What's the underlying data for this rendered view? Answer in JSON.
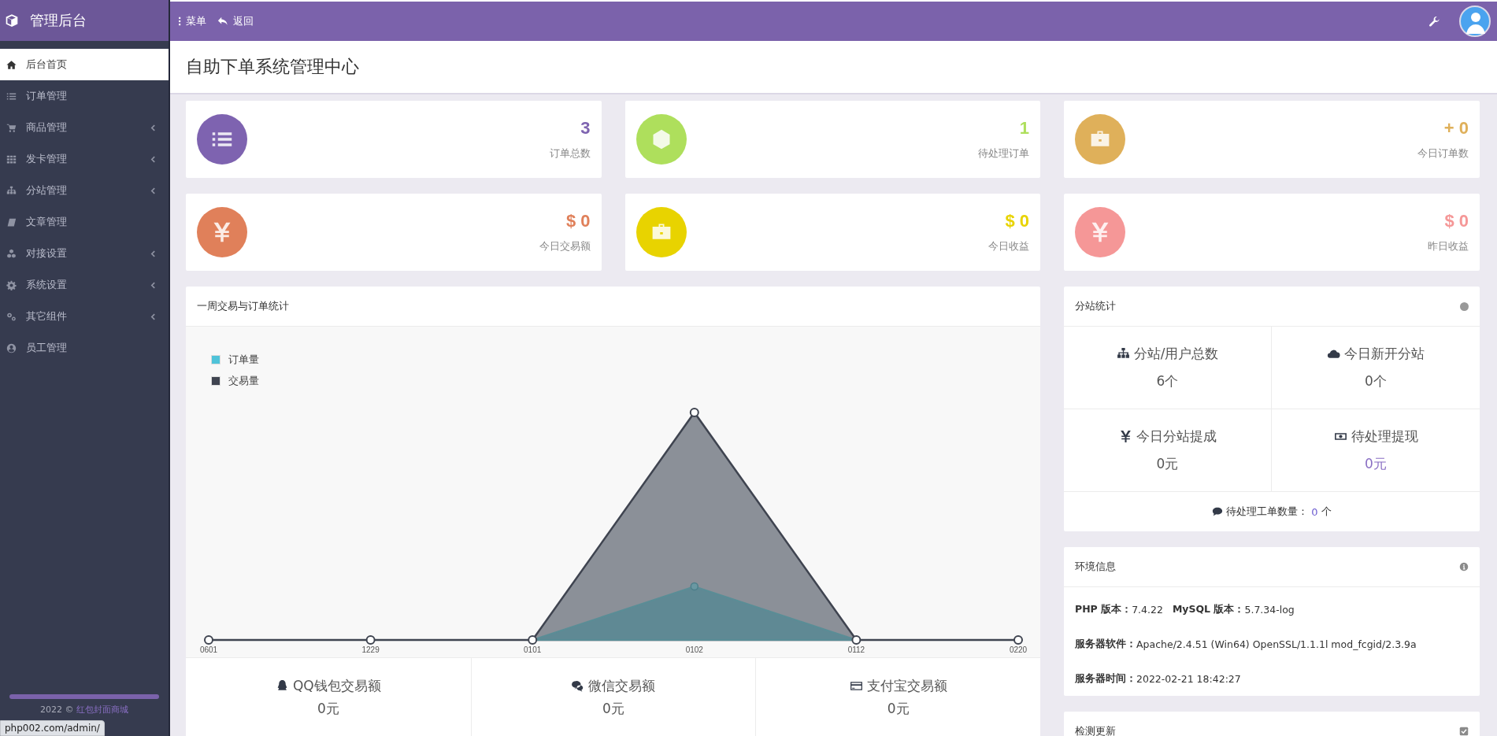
{
  "brand": {
    "title": "管理后台"
  },
  "topbar": {
    "menu": "菜单",
    "back": "返回"
  },
  "sidebar": {
    "items": [
      {
        "label": "后台首页",
        "kind": "home",
        "selected": true,
        "expandable": false
      },
      {
        "label": "订单管理",
        "kind": "list",
        "selected": false,
        "expandable": false
      },
      {
        "label": "商品管理",
        "kind": "cart",
        "selected": false,
        "expandable": true
      },
      {
        "label": "发卡管理",
        "kind": "grid",
        "selected": false,
        "expandable": true
      },
      {
        "label": "分站管理",
        "kind": "sitemap",
        "selected": false,
        "expandable": true
      },
      {
        "label": "文章管理",
        "kind": "book",
        "selected": false,
        "expandable": false
      },
      {
        "label": "对接设置",
        "kind": "cubes",
        "selected": false,
        "expandable": true
      },
      {
        "label": "系统设置",
        "kind": "gear",
        "selected": false,
        "expandable": true
      },
      {
        "label": "其它组件",
        "kind": "cogs",
        "selected": false,
        "expandable": true
      },
      {
        "label": "员工管理",
        "kind": "user",
        "selected": false,
        "expandable": false
      }
    ],
    "footer_year": "2022 ©",
    "footer_link": "红包封面商城"
  },
  "page_title": "自助下单系统管理中心",
  "stats": [
    {
      "value": "3",
      "label": "订单总数",
      "color": "#7e63b0",
      "kind": "list"
    },
    {
      "value": "1",
      "label": "待处理订单",
      "color": "#aedf5c",
      "kind": "hexagon"
    },
    {
      "value": "+ 0",
      "label": "今日订单数",
      "color": "#dfb05a",
      "kind": "briefcase"
    },
    {
      "value": "$ 0",
      "label": "今日交易额",
      "color": "#e0805a",
      "kind": "yen"
    },
    {
      "value": "$ 0",
      "label": "今日收益",
      "color": "#e8d300",
      "kind": "briefcase"
    },
    {
      "value": "$ 0",
      "label": "昨日收益",
      "color": "#f59797",
      "kind": "yen"
    }
  ],
  "chart_panel": {
    "title": "一周交易与订单统计",
    "legend": [
      {
        "label": "订单量",
        "color": "#4fc3d9"
      },
      {
        "label": "交易量",
        "color": "#3f4450"
      }
    ],
    "x_labels": [
      "0601",
      "1229",
      "0101",
      "0102",
      "0112",
      "0220"
    ],
    "payments": [
      {
        "label": "QQ钱包交易额",
        "value": "0元",
        "kind": "qq"
      },
      {
        "label": "微信交易额",
        "value": "0元",
        "kind": "wechat"
      },
      {
        "label": "支付宝交易额",
        "value": "0元",
        "kind": "card"
      }
    ]
  },
  "substation": {
    "title": "分站统计",
    "cells": [
      {
        "label": "分站/用户总数",
        "value": "6个",
        "kind": "sitemap"
      },
      {
        "label": "今日新开分站",
        "value": "0个",
        "kind": "cloud"
      },
      {
        "label": "今日分站提成",
        "value": "0元",
        "kind": "yen"
      },
      {
        "label": "待处理提现",
        "value": "0元",
        "kind": "money"
      }
    ],
    "tickets_label": "待处理工单数量：",
    "tickets_value": "0",
    "tickets_unit": "个"
  },
  "env": {
    "title": "环境信息",
    "rows": [
      [
        {
          "key": "PHP 版本：",
          "value": "7.4.22"
        },
        {
          "key": "MySQL 版本：",
          "value": "5.7.34-log"
        }
      ],
      [
        {
          "key": "服务器软件：",
          "value": "Apache/2.4.51 (Win64) OpenSSL/1.1.1l mod_fcgid/2.3.9a"
        }
      ],
      [
        {
          "key": "服务器时间：",
          "value": "2022-02-21 18:42:27"
        }
      ]
    ]
  },
  "update": {
    "title": "检测更新"
  },
  "status_url": "php002.com/admin/"
}
